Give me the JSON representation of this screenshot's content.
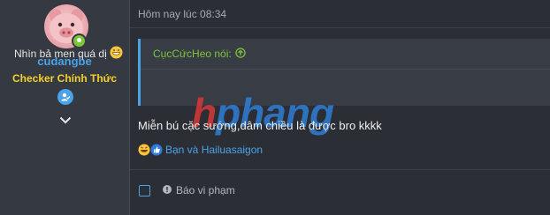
{
  "user": {
    "name": "cudangbe",
    "title": "Checker Chính Thức"
  },
  "post": {
    "timestamp": "Hôm nay lúc 08:34",
    "quote": {
      "author": "CụcCứcHeo nói:",
      "text": "Nhìn bả men quá dị"
    },
    "message": "Miễn bú cặc sướng,dâm chiều là được bro kkkk",
    "reactions_text": "Bạn và Hailuasaigon",
    "report_label": "Báo vi phạm"
  },
  "watermark": {
    "h": "h",
    "rest": "phang"
  },
  "colors": {
    "accent": "#4aa3e8",
    "online": "#7ec53a",
    "title_gold": "#f4d12a"
  },
  "icons": [
    "pig-avatar",
    "online-status-icon",
    "verified-badge-icon",
    "chevron-down-icon",
    "quote-jump-icon",
    "grin-emoji-icon",
    "haha-reaction-icon",
    "like-reaction-icon",
    "report-icon"
  ]
}
